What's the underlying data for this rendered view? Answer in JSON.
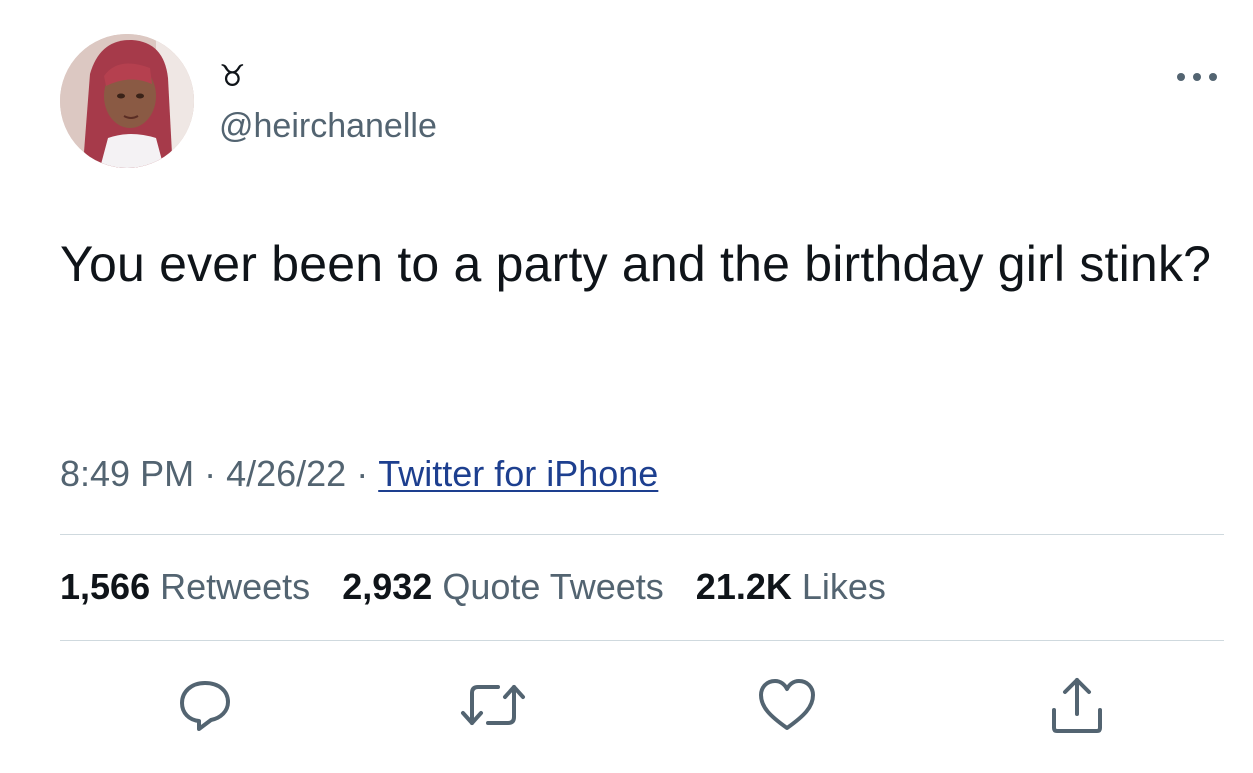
{
  "author": {
    "display_name": "♉",
    "handle": "@heirchanelle"
  },
  "tweet": {
    "text": "You ever been to a party and the birthday girl stink?",
    "time": "8:49 PM",
    "date": "4/26/22",
    "separator": "·",
    "source": "Twitter for iPhone"
  },
  "stats": {
    "retweets": {
      "count": "1,566",
      "label": "Retweets"
    },
    "quotes": {
      "count": "2,932",
      "label": "Quote Tweets"
    },
    "likes": {
      "count": "21.2K",
      "label": "Likes"
    }
  },
  "icons": {
    "more": "more-icon",
    "reply": "reply-icon",
    "retweet": "retweet-icon",
    "like": "like-icon",
    "share": "share-icon"
  },
  "colors": {
    "text": "#0f1419",
    "secondary": "#536471",
    "link": "#1d3f8f",
    "divider": "#cfd9de"
  }
}
